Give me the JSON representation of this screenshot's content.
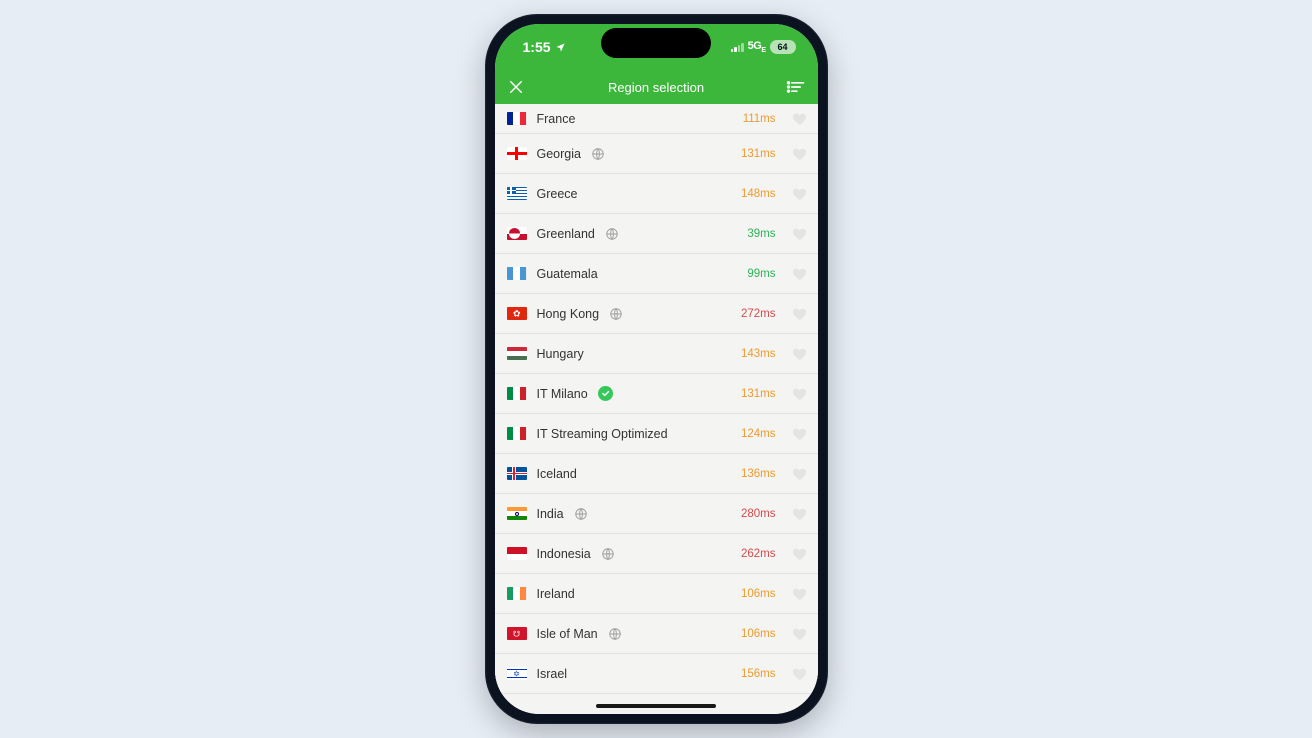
{
  "status": {
    "time": "1:55",
    "network_label": "5G",
    "network_sub": "E",
    "battery_pct": "64"
  },
  "nav": {
    "title": "Region selection"
  },
  "latency_colors": {
    "green": "#2fb357",
    "orange": "#ec9a2f",
    "red": "#d64b4b"
  },
  "regions": [
    {
      "name": "France",
      "latency": "111ms",
      "lat_class": "lat-orange",
      "has_globe": false,
      "has_check": false,
      "flag": "fr"
    },
    {
      "name": "Georgia",
      "latency": "131ms",
      "lat_class": "lat-orange",
      "has_globe": true,
      "has_check": false,
      "flag": "ge"
    },
    {
      "name": "Greece",
      "latency": "148ms",
      "lat_class": "lat-orange",
      "has_globe": false,
      "has_check": false,
      "flag": "gr"
    },
    {
      "name": "Greenland",
      "latency": "39ms",
      "lat_class": "lat-green",
      "has_globe": true,
      "has_check": false,
      "flag": "gl"
    },
    {
      "name": "Guatemala",
      "latency": "99ms",
      "lat_class": "lat-green",
      "has_globe": false,
      "has_check": false,
      "flag": "gt"
    },
    {
      "name": "Hong Kong",
      "latency": "272ms",
      "lat_class": "lat-red",
      "has_globe": true,
      "has_check": false,
      "flag": "hk"
    },
    {
      "name": "Hungary",
      "latency": "143ms",
      "lat_class": "lat-orange",
      "has_globe": false,
      "has_check": false,
      "flag": "hu"
    },
    {
      "name": "IT Milano",
      "latency": "131ms",
      "lat_class": "lat-orange",
      "has_globe": false,
      "has_check": true,
      "flag": "it"
    },
    {
      "name": "IT Streaming Optimized",
      "latency": "124ms",
      "lat_class": "lat-orange",
      "has_globe": false,
      "has_check": false,
      "flag": "it"
    },
    {
      "name": "Iceland",
      "latency": "136ms",
      "lat_class": "lat-orange",
      "has_globe": false,
      "has_check": false,
      "flag": "is"
    },
    {
      "name": "India",
      "latency": "280ms",
      "lat_class": "lat-red",
      "has_globe": true,
      "has_check": false,
      "flag": "in"
    },
    {
      "name": "Indonesia",
      "latency": "262ms",
      "lat_class": "lat-red",
      "has_globe": true,
      "has_check": false,
      "flag": "id"
    },
    {
      "name": "Ireland",
      "latency": "106ms",
      "lat_class": "lat-orange",
      "has_globe": false,
      "has_check": false,
      "flag": "ie"
    },
    {
      "name": "Isle of Man",
      "latency": "106ms",
      "lat_class": "lat-orange",
      "has_globe": true,
      "has_check": false,
      "flag": "im"
    },
    {
      "name": "Israel",
      "latency": "156ms",
      "lat_class": "lat-orange",
      "has_globe": false,
      "has_check": false,
      "flag": "il"
    }
  ]
}
